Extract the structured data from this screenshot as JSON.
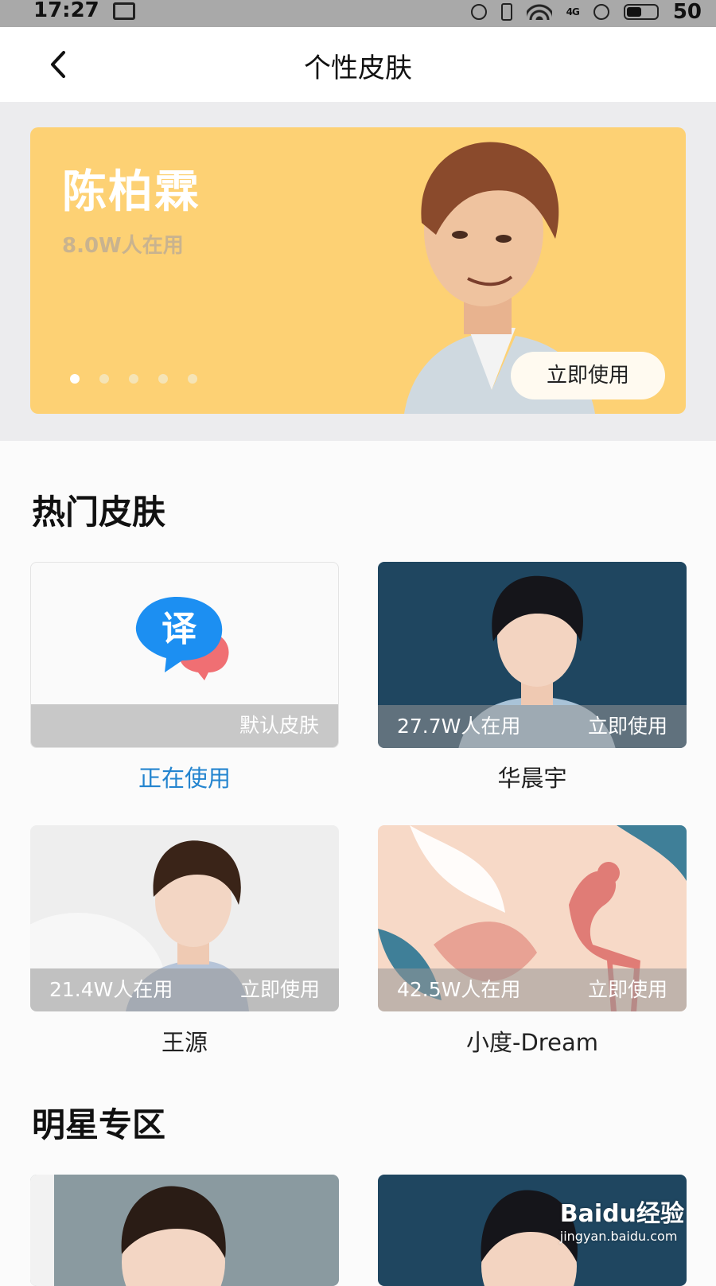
{
  "status_bar": {
    "time": "17:27",
    "network": "4G",
    "battery_text": "50"
  },
  "header": {
    "title": "个性皮肤"
  },
  "banner": {
    "name": "陈柏霖",
    "users": "8.0W人在用",
    "button": "立即使用",
    "background": "#fdd174",
    "dot_count": 5,
    "active_dot": 1
  },
  "hot_section": {
    "title": "热门皮肤",
    "cards": [
      {
        "name": "正在使用",
        "bar_left": "",
        "bar_right": "默认皮肤",
        "state": "active"
      },
      {
        "name": "华晨宇",
        "bar_left": "27.7W人在用",
        "bar_right": "立即使用"
      },
      {
        "name": "王源",
        "bar_left": "21.4W人在用",
        "bar_right": "立即使用"
      },
      {
        "name": "小度-Dream",
        "bar_left": "42.5W人在用",
        "bar_right": "立即使用"
      }
    ]
  },
  "star_section": {
    "title": "明星专区"
  },
  "watermark": {
    "logo": "Baidu经验",
    "url": "jingyan.baidu.com"
  },
  "colors": {
    "accent_blue": "#2384cf",
    "banner_yellow": "#fdd174",
    "card_navy": "#1f4660"
  }
}
